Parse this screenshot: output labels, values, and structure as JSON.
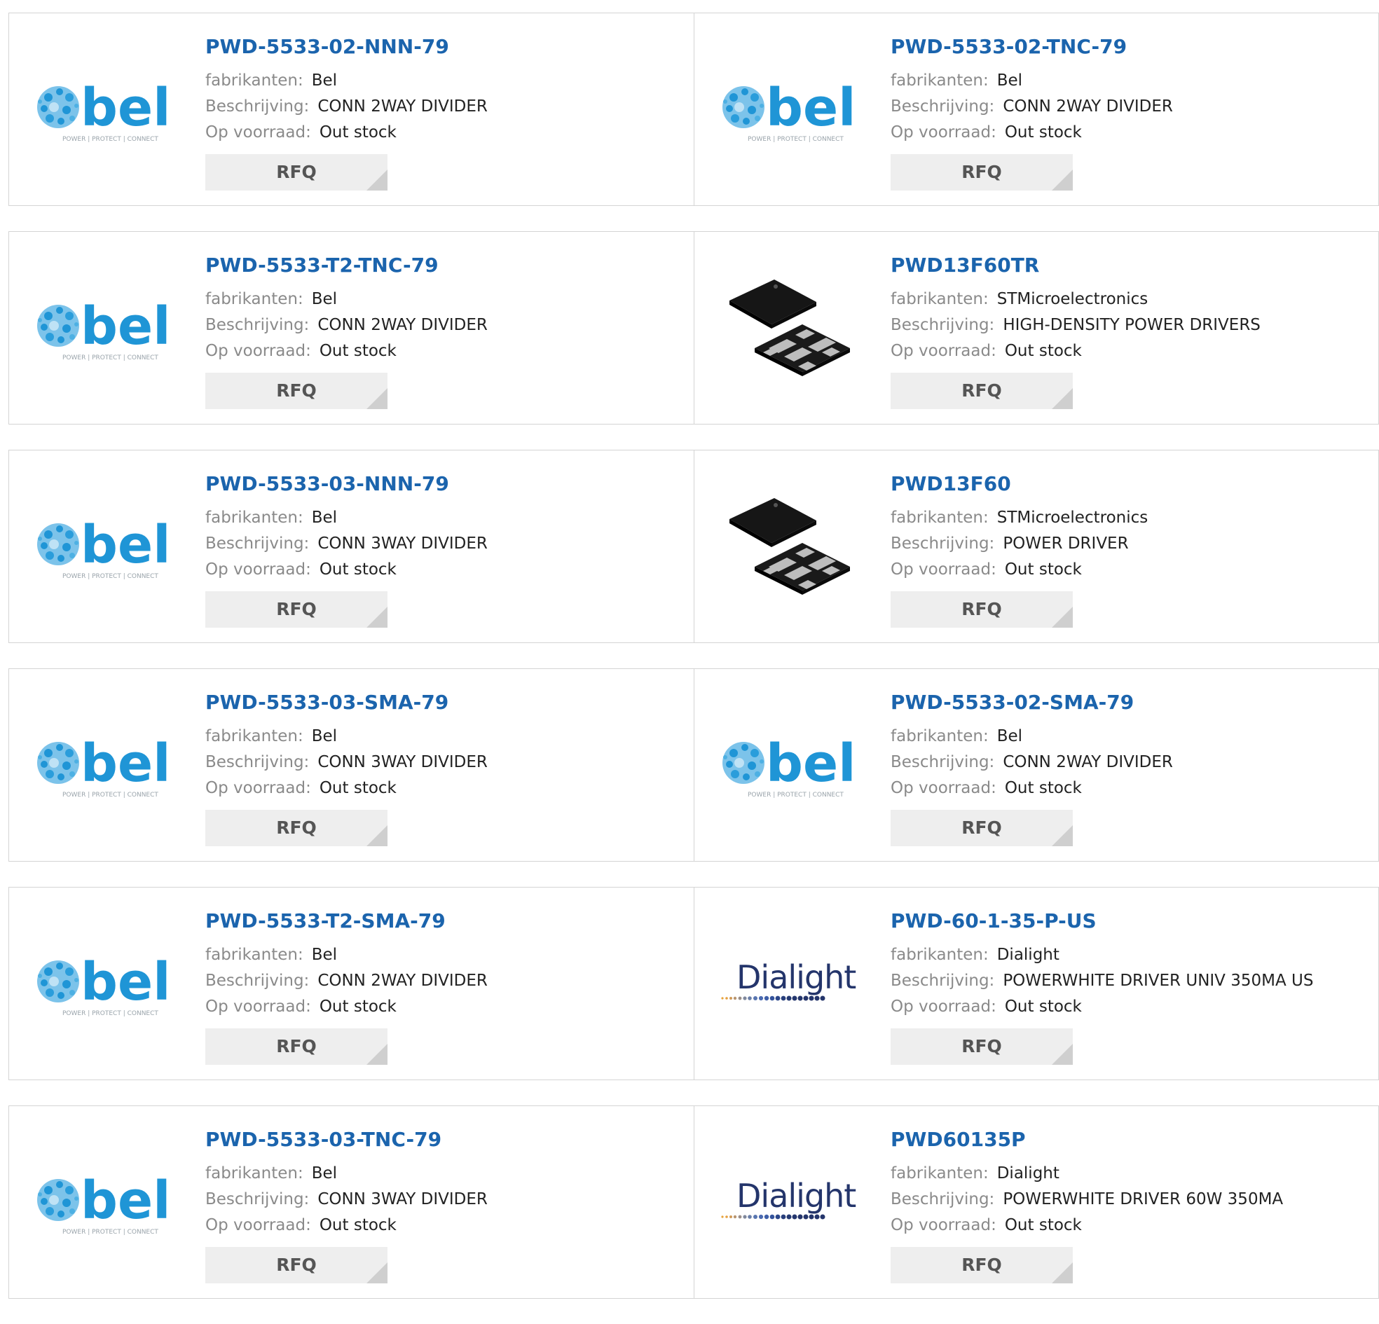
{
  "labels": {
    "manufacturer": "fabrikanten:",
    "description": "Beschrijving:",
    "stock": "Op voorraad:",
    "rfq": "RFQ"
  },
  "logos": {
    "bel": {
      "name": "bel",
      "tagline": "POWER | PROTECT | CONNECT"
    },
    "dialight": {
      "name": "Dialight"
    }
  },
  "colors": {
    "link": "#1b64ad",
    "bel_blue": "#1f95d6",
    "dialight_navy": "#24356b"
  },
  "products": [
    {
      "part_number": "PWD-5533-02-NNN-79",
      "manufacturer": "Bel",
      "description": "CONN 2WAY DIVIDER",
      "stock": "Out stock",
      "logo": "bel-logo"
    },
    {
      "part_number": "PWD-5533-02-TNC-79",
      "manufacturer": "Bel",
      "description": "CONN 2WAY DIVIDER",
      "stock": "Out stock",
      "logo": "bel-logo"
    },
    {
      "part_number": "PWD-5533-T2-TNC-79",
      "manufacturer": "Bel",
      "description": "CONN 2WAY DIVIDER",
      "stock": "Out stock",
      "logo": "bel-logo"
    },
    {
      "part_number": "PWD13F60TR",
      "manufacturer": "STMicroelectronics",
      "description": "HIGH-DENSITY POWER DRIVERS",
      "stock": "Out stock",
      "logo": "chip-package-image"
    },
    {
      "part_number": "PWD-5533-03-NNN-79",
      "manufacturer": "Bel",
      "description": "CONN 3WAY DIVIDER",
      "stock": "Out stock",
      "logo": "bel-logo"
    },
    {
      "part_number": "PWD13F60",
      "manufacturer": "STMicroelectronics",
      "description": "POWER DRIVER",
      "stock": "Out stock",
      "logo": "chip-package-image"
    },
    {
      "part_number": "PWD-5533-03-SMA-79",
      "manufacturer": "Bel",
      "description": "CONN 3WAY DIVIDER",
      "stock": "Out stock",
      "logo": "bel-logo"
    },
    {
      "part_number": "PWD-5533-02-SMA-79",
      "manufacturer": "Bel",
      "description": "CONN 2WAY DIVIDER",
      "stock": "Out stock",
      "logo": "bel-logo"
    },
    {
      "part_number": "PWD-5533-T2-SMA-79",
      "manufacturer": "Bel",
      "description": "CONN 2WAY DIVIDER",
      "stock": "Out stock",
      "logo": "bel-logo"
    },
    {
      "part_number": "PWD-60-1-35-P-US",
      "manufacturer": "Dialight",
      "description": "POWERWHITE DRIVER UNIV 350MA US",
      "stock": "Out stock",
      "logo": "dialight-logo"
    },
    {
      "part_number": "PWD-5533-03-TNC-79",
      "manufacturer": "Bel",
      "description": "CONN 3WAY DIVIDER",
      "stock": "Out stock",
      "logo": "bel-logo"
    },
    {
      "part_number": "PWD60135P",
      "manufacturer": "Dialight",
      "description": "POWERWHITE DRIVER 60W 350MA",
      "stock": "Out stock",
      "logo": "dialight-logo"
    }
  ]
}
